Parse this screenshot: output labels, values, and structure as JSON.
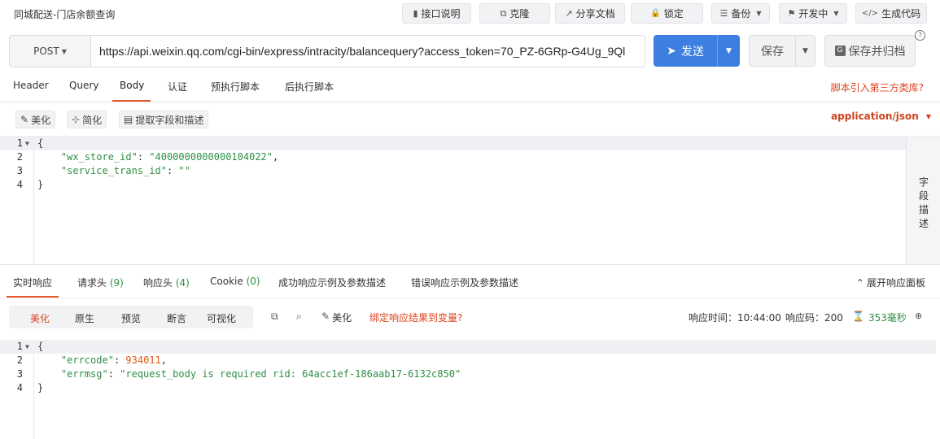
{
  "header": {
    "title": "同城配送-门店余额查询",
    "buttons": [
      {
        "label": "接口说明",
        "icon": "document-icon",
        "glyph": "▮"
      },
      {
        "label": "克隆",
        "icon": "copy-icon",
        "glyph": "⧉"
      },
      {
        "label": "分享文档",
        "icon": "share-icon",
        "glyph": "↗"
      },
      {
        "label": "锁定",
        "icon": "lock-icon",
        "glyph": "🔒"
      },
      {
        "label": "备份",
        "icon": "database-icon",
        "glyph": "☰"
      },
      {
        "label": "开发中",
        "icon": "flag-icon",
        "glyph": "⚑"
      },
      {
        "label": "生成代码",
        "icon": "code-icon",
        "glyph": "</>"
      }
    ]
  },
  "request": {
    "method": "POST",
    "url": "https://api.weixin.qq.com/cgi-bin/express/intracity/balancequery?access_token=70_PZ-6GRp-G4Ug_9Ql",
    "send_label": "发送",
    "save_label": "保存",
    "save_archive_label": "保存并归档",
    "help_glyph": "?"
  },
  "request_tabs": [
    "Header",
    "Query",
    "Body",
    "认证",
    "预执行脚本",
    "后执行脚本"
  ],
  "request_active_tab": "Body",
  "third_party_link": "脚本引入第三方类库?",
  "body_toolbar": {
    "beautify": "美化",
    "simplify": "简化",
    "extract": "提取字段和描述",
    "content_type": "application/json"
  },
  "request_body_lines": [
    {
      "n": "1",
      "text": "{"
    },
    {
      "n": "2",
      "key": "\"wx_store_id\"",
      "value": "\"4000000000000104022\"",
      "tail": ","
    },
    {
      "n": "3",
      "key": "\"service_trans_id\"",
      "value": "\"\"",
      "tail": ""
    },
    {
      "n": "4",
      "text": "}"
    }
  ],
  "side_panel_label": "字段描述",
  "response_tabs": [
    {
      "label": "实时响应",
      "count": ""
    },
    {
      "label": "请求头",
      "count": "(9)"
    },
    {
      "label": "响应头",
      "count": "(4)"
    },
    {
      "label": "Cookie",
      "count": "(0)"
    },
    {
      "label": "成功响应示例及参数描述",
      "count": ""
    },
    {
      "label": "错误响应示例及参数描述",
      "count": ""
    }
  ],
  "expand_panel": "展开响应面板",
  "response_view_modes": [
    "美化",
    "原生",
    "预览",
    "断言",
    "可视化"
  ],
  "response_active_mode": "美化",
  "response_toolbar": {
    "beautify": "美化",
    "bind_var": "绑定响应结果到变量?"
  },
  "response_meta": {
    "time_label": "响应时间：",
    "time_value": "10:44:00",
    "code_label": "响应码：",
    "code_value": "200",
    "duration": "353毫秒"
  },
  "response_body_lines": [
    {
      "n": "1",
      "text": "{"
    },
    {
      "n": "2",
      "key": "\"errcode\"",
      "value": "934011",
      "tail": ","
    },
    {
      "n": "3",
      "key": "\"errmsg\"",
      "value": "\"request_body is required rid: 64acc1ef-186aab17-6132c850\"",
      "tail": ""
    },
    {
      "n": "4",
      "text": "}"
    }
  ],
  "colors": {
    "accent": "#e4572e",
    "send": "#3d7fe0",
    "json_key": "#2f8f46",
    "json_number": "#e05c15"
  }
}
